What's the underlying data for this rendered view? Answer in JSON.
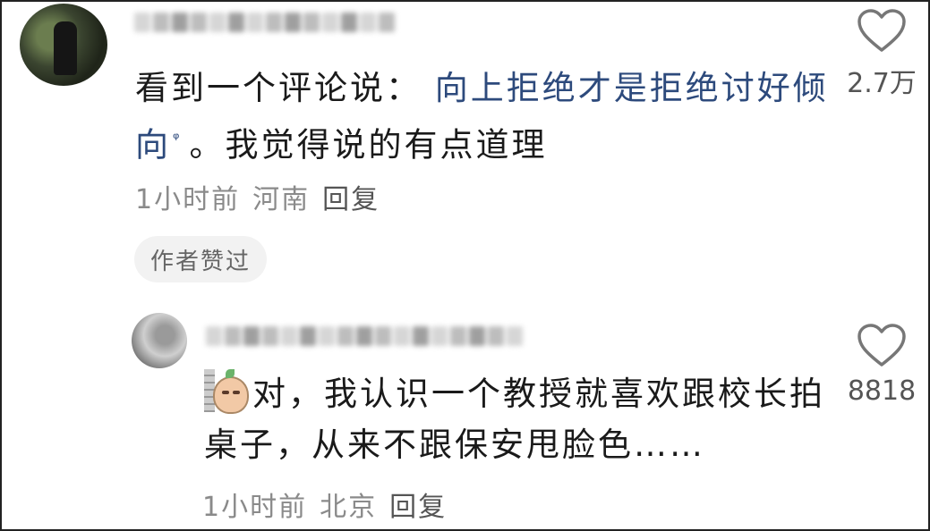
{
  "comment": {
    "text_prefix": "看到一个评论说：",
    "link_text": "向上拒绝才是拒绝讨好倾向",
    "search_mark": "ᵠ",
    "text_suffix": "。我觉得说的有点道理",
    "time": "1小时前",
    "location": "河南",
    "reply_label": "回复",
    "author_liked": "作者赞过",
    "likes": "2.7万"
  },
  "reply": {
    "text": "对，我认识一个教授就喜欢跟校长拍桌子，从来不跟保安甩脸色……",
    "time": "1小时前",
    "location": "北京",
    "reply_label": "回复",
    "likes": "8818"
  },
  "icons": {
    "like": "heart-outline-icon",
    "sticker": "potato-peek-sticker"
  },
  "colors": {
    "link": "#2d4a7c",
    "meta": "#8a8a8a"
  }
}
